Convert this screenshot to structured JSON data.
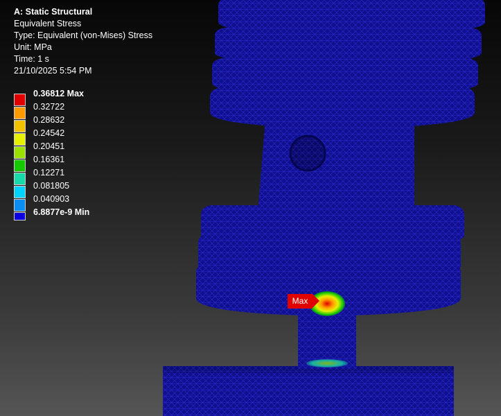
{
  "info": {
    "analysis": "A: Static Structural",
    "result": "Equivalent Stress",
    "type": "Type: Equivalent (von-Mises) Stress",
    "unit": "Unit: MPa",
    "time": "Time: 1 s",
    "timestamp": "21/10/2025 5:54 PM"
  },
  "legend": {
    "levels": [
      {
        "label": "0.36812 Max",
        "color": "#e00000",
        "bold": true
      },
      {
        "label": "0.32722",
        "color": "#ff9a00",
        "bold": false
      },
      {
        "label": "0.28632",
        "color": "#f2c200",
        "bold": false
      },
      {
        "label": "0.24542",
        "color": "#e6f000",
        "bold": false
      },
      {
        "label": "0.20451",
        "color": "#9ae000",
        "bold": false
      },
      {
        "label": "0.16361",
        "color": "#16c800",
        "bold": false
      },
      {
        "label": "0.12271",
        "color": "#17d9a9",
        "bold": false
      },
      {
        "label": "0.081805",
        "color": "#00d3ff",
        "bold": false
      },
      {
        "label": "0.040903",
        "color": "#0a8df2",
        "bold": false
      },
      {
        "label": "6.8877e-9 Min",
        "color": "#0a00e0",
        "bold": true
      }
    ]
  },
  "probe": {
    "label": "Max",
    "color": "#e00000"
  },
  "mesh_color": "#0a0aa8"
}
